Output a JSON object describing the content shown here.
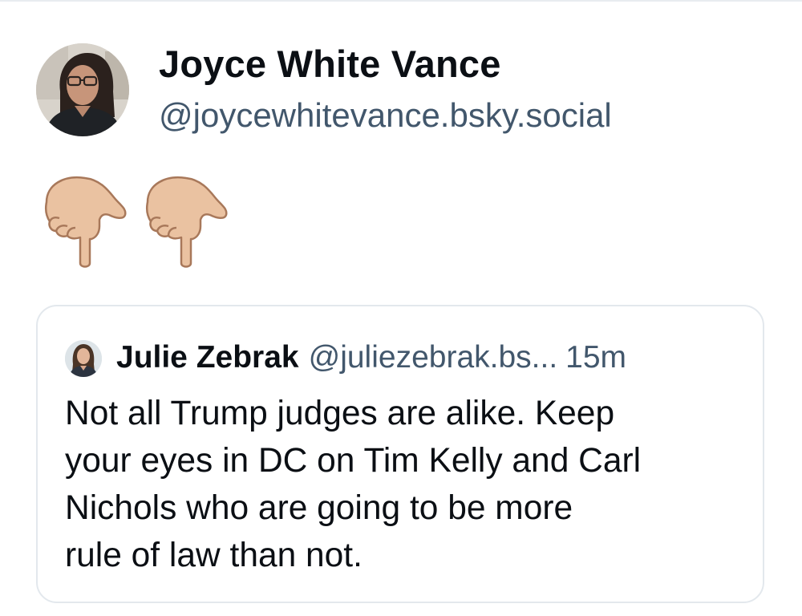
{
  "post": {
    "author": {
      "display_name": "Joyce White Vance",
      "handle": "@joycewhitevance.bsky.social",
      "avatar": "profile-photo"
    },
    "text_emoji": [
      "backhand-index-pointing-down",
      "backhand-index-pointing-down"
    ],
    "emoji_color": "#e9c1a0"
  },
  "quoted_post": {
    "author": {
      "display_name": "Julie Zebrak",
      "handle": "@juliezebrak.bs...",
      "avatar": "profile-photo"
    },
    "time_ago": "15m",
    "text": "Not all Trump judges are alike. Keep\nyour eyes in DC on Tim Kelly and Carl\nNichols who are going to be more\nrule of law than not."
  },
  "colors": {
    "text_primary": "#0b0f14",
    "text_secondary": "#42576c",
    "card_border": "#e3e8ed"
  }
}
